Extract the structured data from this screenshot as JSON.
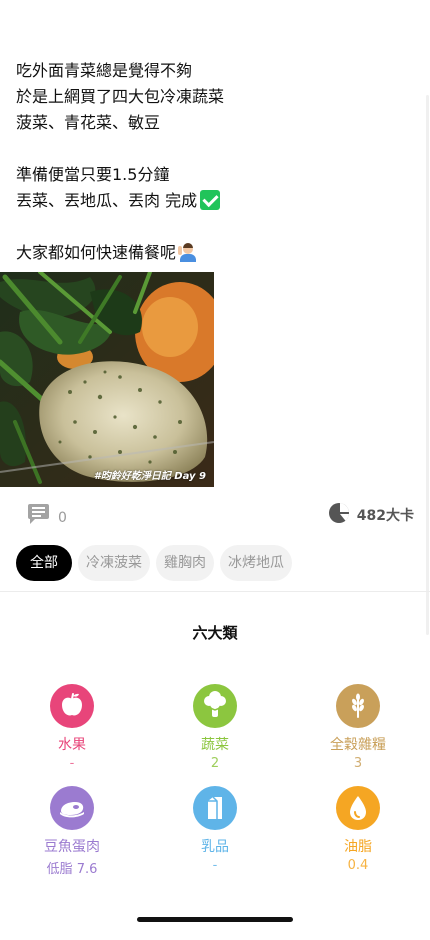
{
  "post": {
    "lines": [
      "吃外面青菜總是覺得不夠",
      "於是上網買了四大包冷凍蔬菜",
      "菠菜、青花菜、敏豆",
      "",
      "準備便當只要1.5分鐘",
      "丟菜、丟地瓜、丟肉 完成",
      "",
      "大家都如何快速備餐呢"
    ],
    "line5_emoji": "check-mark-emoji",
    "line7_emoji": "person-raising-hand-emoji"
  },
  "photo": {
    "caption": "#昀鈴好乾淨日記 Day 9"
  },
  "stats": {
    "comment_count": "0",
    "calories": "482大卡"
  },
  "tags": [
    {
      "label": "全部",
      "active": true
    },
    {
      "label": "冷凍菠菜",
      "active": false
    },
    {
      "label": "雞胸肉",
      "active": false
    },
    {
      "label": "冰烤地瓜",
      "active": false
    }
  ],
  "nutrition": {
    "title": "六大類",
    "items": [
      {
        "label": "水果",
        "value": "-",
        "icon": "apple-icon",
        "color": "#e8457a"
      },
      {
        "label": "蔬菜",
        "value": "2",
        "icon": "broccoli-icon",
        "color": "#8cc63f"
      },
      {
        "label": "全穀雜糧",
        "value": "3",
        "icon": "grain-icon",
        "color": "#c9a05a"
      },
      {
        "label": "豆魚蛋肉",
        "value": "低脂 7.6",
        "icon": "meat-icon",
        "color": "#9b7bd0"
      },
      {
        "label": "乳品",
        "value": "-",
        "icon": "milk-icon",
        "color": "#5fb4e8"
      },
      {
        "label": "油脂",
        "value": "0.4",
        "icon": "oil-drop-icon",
        "color": "#f5a623"
      }
    ]
  }
}
